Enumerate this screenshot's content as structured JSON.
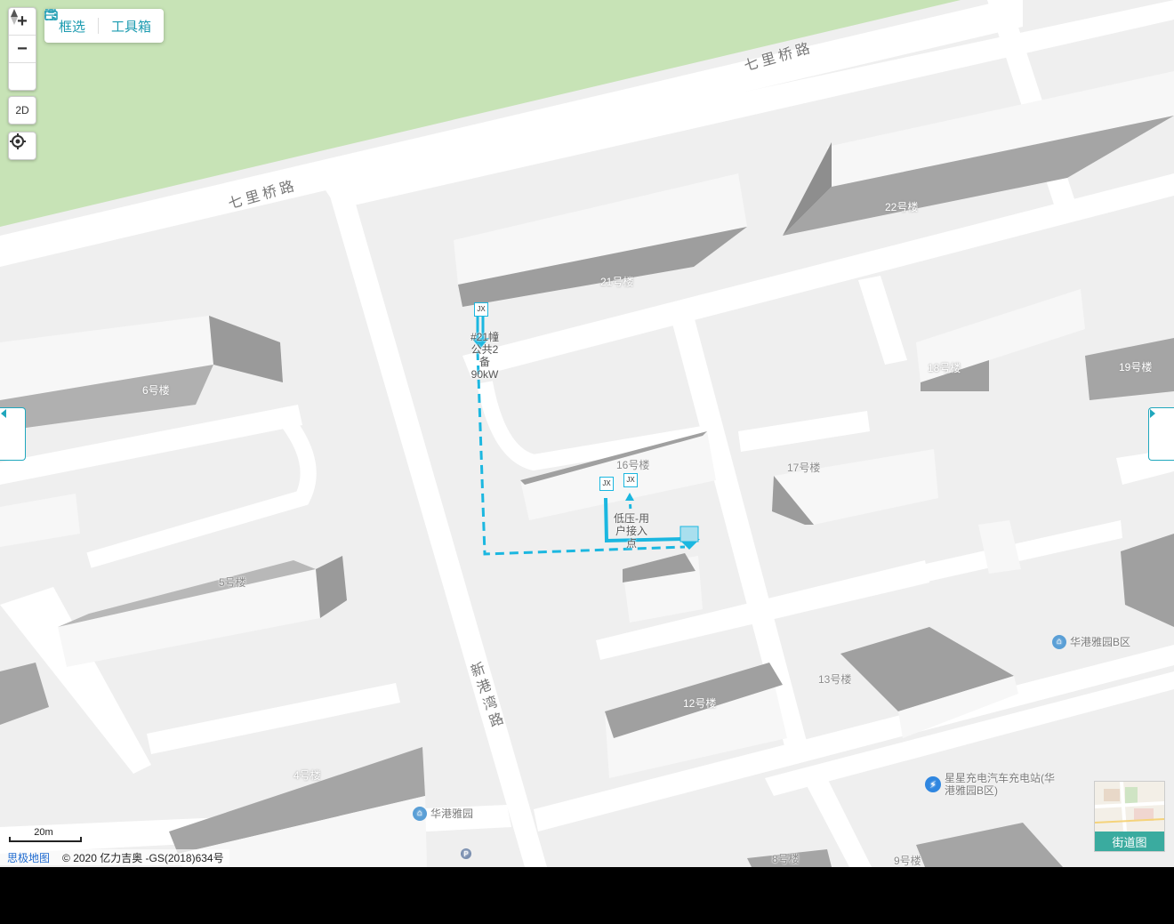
{
  "map_controls": {
    "zoom_in": "+",
    "zoom_out": "−",
    "compass_icon": "compass-icon",
    "mode_toggle": "2D",
    "locate_icon": "locate-icon"
  },
  "toolbar": {
    "select_label": "框选",
    "select_icon": "box-select-icon",
    "toolbox_label": "工具箱",
    "toolbox_icon": "toolbox-icon"
  },
  "side_toggles": {
    "left_icon": "caret-left-icon",
    "right_icon": "caret-right-icon"
  },
  "roads": {
    "north_upper": "七里桥路",
    "north_lower": "七里桥路",
    "vertical": "新港湾路"
  },
  "buildings": {
    "b21": "21号楼",
    "b22": "22号楼",
    "b6": "6号楼",
    "b18": "18号楼",
    "b19": "19号楼",
    "b16": "16号楼",
    "b17": "17号楼",
    "b5": "5号楼",
    "b13": "13号楼",
    "b12": "12号楼",
    "b4": "4号楼",
    "b8": "8号楼",
    "b9": "9号楼"
  },
  "pois": {
    "huagang_b": "华港雅园B区",
    "charger": "星星充电汽车充电站(华港雅园B区)",
    "huagang": "华港雅园"
  },
  "overlay": {
    "equipment_label": "#21幢公共2备90kW",
    "user_access_label": "低压-用户接入点",
    "jx_tag_1": "JX",
    "jx_tag_2": "JX",
    "top_tag": "JX",
    "line_color": "#1bb7e0"
  },
  "scale": {
    "label": "20m"
  },
  "attribution": {
    "brand_link": "思极地图",
    "copyright": "© 2020 亿力吉奥 -GS(2018)634号"
  },
  "street_view": {
    "label": "街道图"
  }
}
